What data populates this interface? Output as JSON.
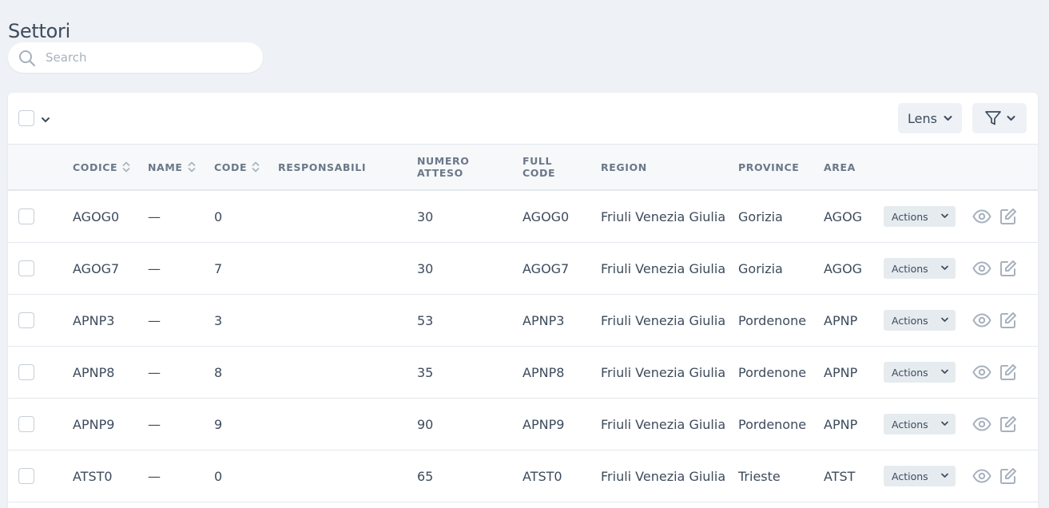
{
  "page": {
    "title": "Settori"
  },
  "search": {
    "placeholder": "Search",
    "value": ""
  },
  "toolbar": {
    "lens_label": "Lens"
  },
  "columns": [
    {
      "label": "CODICE",
      "sortable": true
    },
    {
      "label": "NAME",
      "sortable": true
    },
    {
      "label": "CODE",
      "sortable": true
    },
    {
      "label": "RESPONSABILI",
      "sortable": false
    },
    {
      "label": "NUMERO ATTESO",
      "sortable": false
    },
    {
      "label": "FULL CODE",
      "sortable": false
    },
    {
      "label": "REGION",
      "sortable": false
    },
    {
      "label": "PROVINCE",
      "sortable": false
    },
    {
      "label": "AREA",
      "sortable": false
    }
  ],
  "rows": [
    {
      "codice": "AGOG0",
      "name": "—",
      "code": "0",
      "responsabili": "",
      "numero_atteso": "30",
      "full_code": "AGOG0",
      "region": "Friuli Venezia Giulia",
      "province": "Gorizia",
      "area": "AGOG",
      "actions_label": "Actions"
    },
    {
      "codice": "AGOG7",
      "name": "—",
      "code": "7",
      "responsabili": "",
      "numero_atteso": "30",
      "full_code": "AGOG7",
      "region": "Friuli Venezia Giulia",
      "province": "Gorizia",
      "area": "AGOG",
      "actions_label": "Actions"
    },
    {
      "codice": "APNP3",
      "name": "—",
      "code": "3",
      "responsabili": "",
      "numero_atteso": "53",
      "full_code": "APNP3",
      "region": "Friuli Venezia Giulia",
      "province": "Pordenone",
      "area": "APNP",
      "actions_label": "Actions"
    },
    {
      "codice": "APNP8",
      "name": "—",
      "code": "8",
      "responsabili": "",
      "numero_atteso": "35",
      "full_code": "APNP8",
      "region": "Friuli Venezia Giulia",
      "province": "Pordenone",
      "area": "APNP",
      "actions_label": "Actions"
    },
    {
      "codice": "APNP9",
      "name": "—",
      "code": "9",
      "responsabili": "",
      "numero_atteso": "90",
      "full_code": "APNP9",
      "region": "Friuli Venezia Giulia",
      "province": "Pordenone",
      "area": "APNP",
      "actions_label": "Actions"
    },
    {
      "codice": "ATST0",
      "name": "—",
      "code": "0",
      "responsabili": "",
      "numero_atteso": "65",
      "full_code": "ATST0",
      "region": "Friuli Venezia Giulia",
      "province": "Trieste",
      "area": "ATST",
      "actions_label": "Actions"
    }
  ],
  "icons": {
    "search": "search-icon",
    "sort": "sort-icon",
    "filter": "funnel-icon",
    "view": "eye-icon",
    "edit": "edit-icon",
    "dropdown": "chevron-down-icon"
  },
  "colors": {
    "background": "#eef1f5",
    "text": "#3d4b5c",
    "muted": "#6b7888",
    "icon": "#a7b1be"
  }
}
